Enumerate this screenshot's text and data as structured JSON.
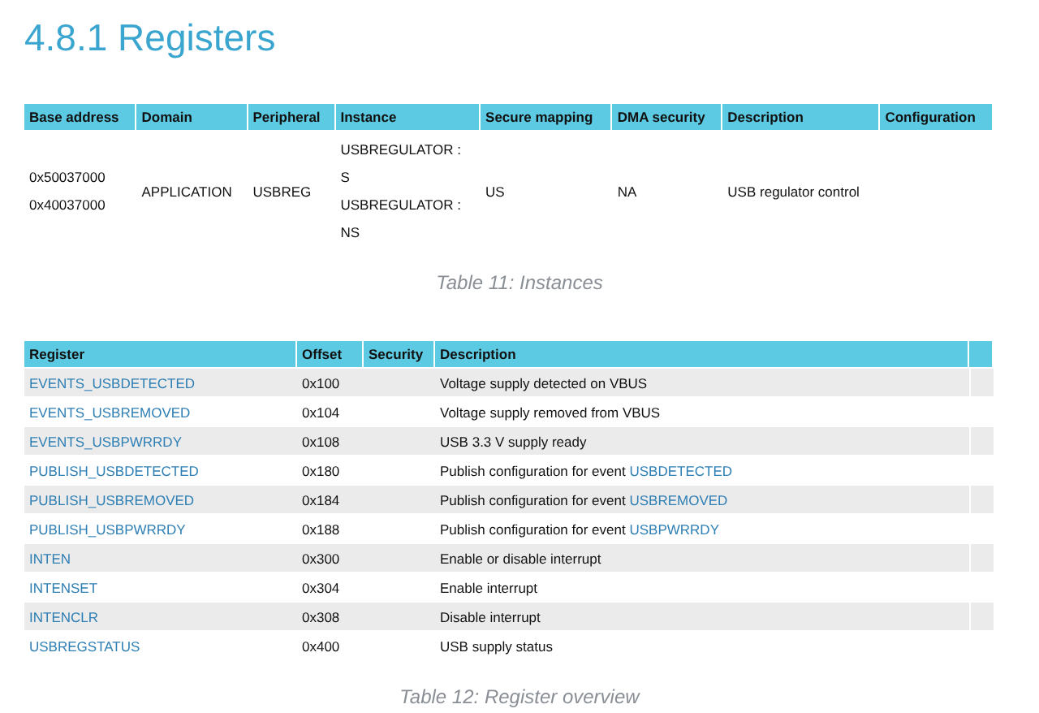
{
  "title": "4.8.1 Registers",
  "instances": {
    "columns": [
      "Base address",
      "Domain",
      "Peripheral",
      "Instance",
      "Secure mapping",
      "DMA security",
      "Description",
      "Configuration"
    ],
    "rows": [
      {
        "base_address": [
          "0x50037000",
          "0x40037000"
        ],
        "domain": "APPLICATION",
        "peripheral": "USBREG",
        "instance": [
          "USBREGULATOR :",
          "S",
          "USBREGULATOR :",
          "NS"
        ],
        "secure_mapping": "US",
        "dma_security": "NA",
        "description": "USB regulator control"
      }
    ],
    "caption": "Table 11: Instances"
  },
  "registers": {
    "columns": [
      "Register",
      "Offset",
      "Security",
      "Description"
    ],
    "rows": [
      {
        "register": "EVENTS_USBDETECTED",
        "offset": "0x100",
        "description": "Voltage supply detected on VBUS"
      },
      {
        "register": "EVENTS_USBREMOVED",
        "offset": "0x104",
        "description": "Voltage supply removed from VBUS"
      },
      {
        "register": "EVENTS_USBPWRRDY",
        "offset": "0x108",
        "description": "USB 3.3 V supply ready"
      },
      {
        "register": "PUBLISH_USBDETECTED",
        "offset": "0x180",
        "description": "Publish configuration for event",
        "link": "USBDETECTED"
      },
      {
        "register": "PUBLISH_USBREMOVED",
        "offset": "0x184",
        "description": "Publish configuration for event",
        "link": "USBREMOVED"
      },
      {
        "register": "PUBLISH_USBPWRRDY",
        "offset": "0x188",
        "description": "Publish configuration for event",
        "link": "USBPWRRDY"
      },
      {
        "register": "INTEN",
        "offset": "0x300",
        "description": "Enable or disable interrupt"
      },
      {
        "register": "INTENSET",
        "offset": "0x304",
        "description": "Enable interrupt"
      },
      {
        "register": "INTENCLR",
        "offset": "0x308",
        "description": "Disable interrupt"
      },
      {
        "register": "USBREGSTATUS",
        "offset": "0x400",
        "description": "USB supply status"
      }
    ],
    "caption": "Table 12: Register overview"
  }
}
